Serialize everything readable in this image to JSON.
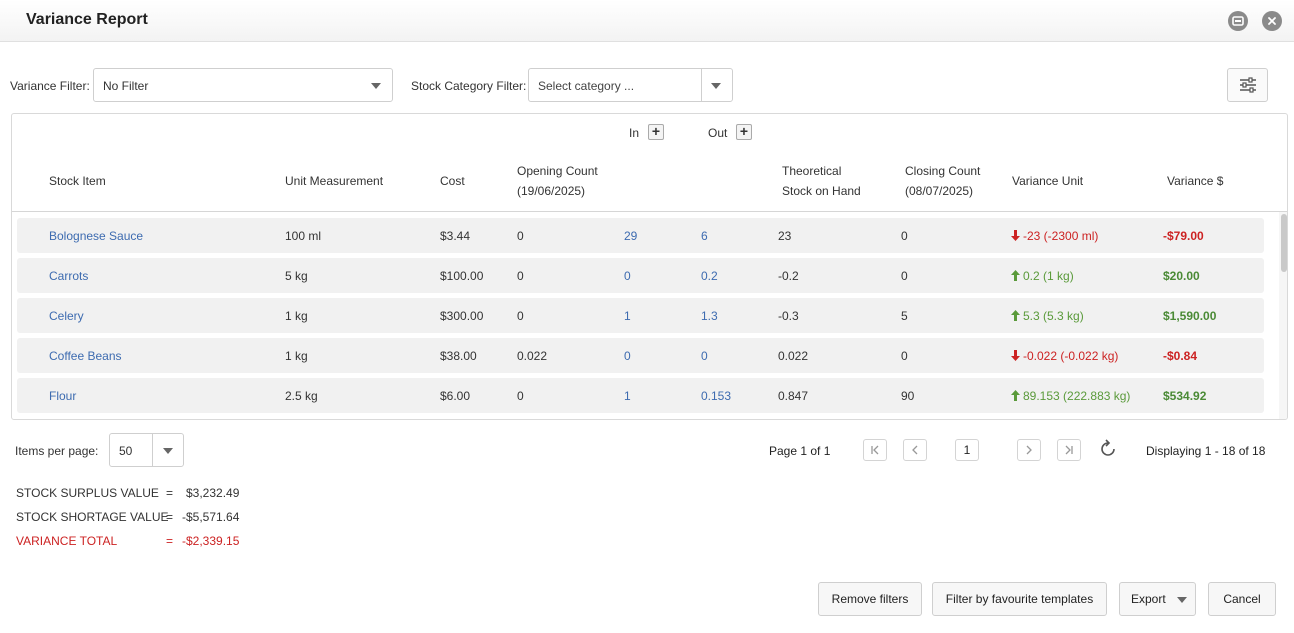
{
  "window": {
    "title": "Variance Report"
  },
  "filters": {
    "variance_label": "Variance Filter:",
    "variance_value": "No Filter",
    "category_label": "Stock Category Filter:",
    "category_placeholder": "Select category ..."
  },
  "table": {
    "group_in": "In",
    "group_out": "Out",
    "headers": {
      "stock_item": "Stock Item",
      "unit": "Unit Measurement",
      "cost": "Cost",
      "opening_1": "Opening Count",
      "opening_2": "(19/06/2025)",
      "theoretical_1": "Theoretical",
      "theoretical_2": "Stock on Hand",
      "closing_1": "Closing Count",
      "closing_2": "(08/07/2025)",
      "variance_unit": "Variance Unit",
      "variance_dollar": "Variance $"
    },
    "rows": [
      {
        "item": "Bolognese Sauce",
        "unit": "100 ml",
        "cost": "$3.44",
        "opening": "0",
        "in": "29",
        "out": "6",
        "theoretical": "23",
        "closing": "0",
        "variance_unit": "-23 (-2300 ml)",
        "variance_dollar": "-$79.00",
        "direction": "down"
      },
      {
        "item": "Carrots",
        "unit": "5 kg",
        "cost": "$100.00",
        "opening": "0",
        "in": "0",
        "out": "0.2",
        "theoretical": "-0.2",
        "closing": "0",
        "variance_unit": "0.2 (1 kg)",
        "variance_dollar": "$20.00",
        "direction": "up"
      },
      {
        "item": "Celery",
        "unit": "1 kg",
        "cost": "$300.00",
        "opening": "0",
        "in": "1",
        "out": "1.3",
        "theoretical": "-0.3",
        "closing": "5",
        "variance_unit": "5.3 (5.3 kg)",
        "variance_dollar": "$1,590.00",
        "direction": "up"
      },
      {
        "item": "Coffee Beans",
        "unit": "1 kg",
        "cost": "$38.00",
        "opening": "0.022",
        "in": "0",
        "out": "0",
        "theoretical": "0.022",
        "closing": "0",
        "variance_unit": "-0.022 (-0.022 kg)",
        "variance_dollar": "-$0.84",
        "direction": "down"
      },
      {
        "item": "Flour",
        "unit": "2.5 kg",
        "cost": "$6.00",
        "opening": "0",
        "in": "1",
        "out": "0.153",
        "theoretical": "0.847",
        "closing": "90",
        "variance_unit": "89.153 (222.883 kg)",
        "variance_dollar": "$534.92",
        "direction": "up"
      }
    ]
  },
  "pagination": {
    "items_per_page_label": "Items per page:",
    "items_per_page_value": "50",
    "page_label": "Page 1 of 1",
    "current_page": "1",
    "displaying": "Displaying 1 - 18 of 18"
  },
  "summary": {
    "surplus_label": "STOCK SURPLUS VALUE",
    "surplus_value": "$3,232.49",
    "shortage_label": "STOCK SHORTAGE VALUE",
    "shortage_value": "-$5,571.64",
    "total_label": "VARIANCE TOTAL",
    "total_value": "-$2,339.15",
    "equals": "="
  },
  "buttons": {
    "remove_filters": "Remove filters",
    "favourite_templates": "Filter by favourite templates",
    "export": "Export",
    "cancel": "Cancel"
  },
  "colors": {
    "link": "#3d6bb0",
    "negative": "#cc2222",
    "positive": "#5a9a3a"
  },
  "icons": [
    "minimize-icon",
    "close-icon",
    "chevron-down-icon",
    "sliders-icon",
    "plus-icon",
    "arrow-up-icon",
    "arrow-down-icon",
    "first-page-icon",
    "prev-page-icon",
    "next-page-icon",
    "last-page-icon",
    "refresh-icon"
  ]
}
